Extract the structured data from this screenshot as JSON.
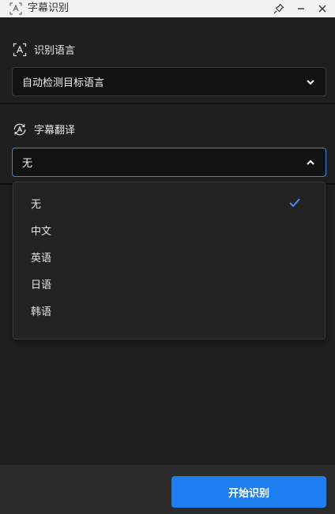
{
  "window": {
    "title": "字幕识别",
    "title_icon": "scan-text-icon",
    "controls": [
      "pin-icon",
      "minimize-icon",
      "close-icon"
    ]
  },
  "recognition": {
    "label": "识别语言",
    "icon": "language-scan-icon",
    "selected": "自动检测目标语言"
  },
  "translation": {
    "label": "字幕翻译",
    "icon": "translate-icon",
    "selected": "无",
    "open": true,
    "options": [
      {
        "label": "无",
        "checked": true
      },
      {
        "label": "中文",
        "checked": false
      },
      {
        "label": "英语",
        "checked": false
      },
      {
        "label": "日语",
        "checked": false
      },
      {
        "label": "韩语",
        "checked": false
      }
    ]
  },
  "footer": {
    "start_label": "开始识别"
  },
  "colors": {
    "accent": "#1e7ff0",
    "focus_border": "#3a86e0",
    "background": "#1f1f1f",
    "titlebar": "#f2f2f2"
  }
}
